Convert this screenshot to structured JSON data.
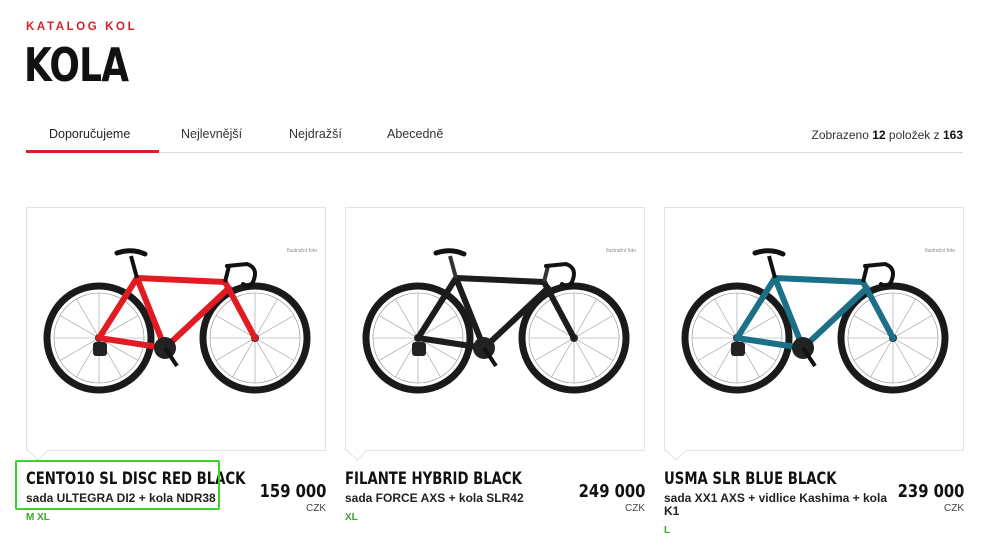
{
  "header": {
    "kicker": "KATALOG KOL",
    "title": "KOLA"
  },
  "tabs": [
    "Doporučujeme",
    "Nejlevnější",
    "Nejdražší",
    "Abecedně"
  ],
  "results": {
    "prefix": "Zobrazeno",
    "shown": "12",
    "middle": "položek z",
    "total": "163"
  },
  "products": [
    {
      "name": "CENTO10 SL DISC RED BLACK",
      "spec": "sada ULTEGRA DI2 + kola NDR38",
      "sizes": "M   XL",
      "price": "159 000",
      "currency": "CZK",
      "illustration": "Ilustrační foto",
      "frame_color": "#e01b22",
      "frame_accent": "#111111",
      "rim_color": "#1a1a1a"
    },
    {
      "name": "FILANTE HYBRID BLACK",
      "spec": "sada FORCE AXS + kola SLR42",
      "sizes": "XL",
      "price": "249 000",
      "currency": "CZK",
      "illustration": "Ilustrační foto",
      "frame_color": "#1c1c1c",
      "frame_accent": "#333333",
      "rim_color": "#1a1a1a"
    },
    {
      "name": "USMA SLR BLUE BLACK",
      "spec": "sada XX1 AXS + vidlice Kashima + kola K1",
      "sizes": "L",
      "price": "239 000",
      "currency": "CZK",
      "illustration": "Ilustrační foto",
      "frame_color": "#1b6f86",
      "frame_accent": "#111111",
      "rim_color": "#1a1a1a"
    }
  ],
  "colors": {
    "accent": "#d4202a",
    "size_green": "#3aa52a",
    "selection": "#39d22e"
  }
}
